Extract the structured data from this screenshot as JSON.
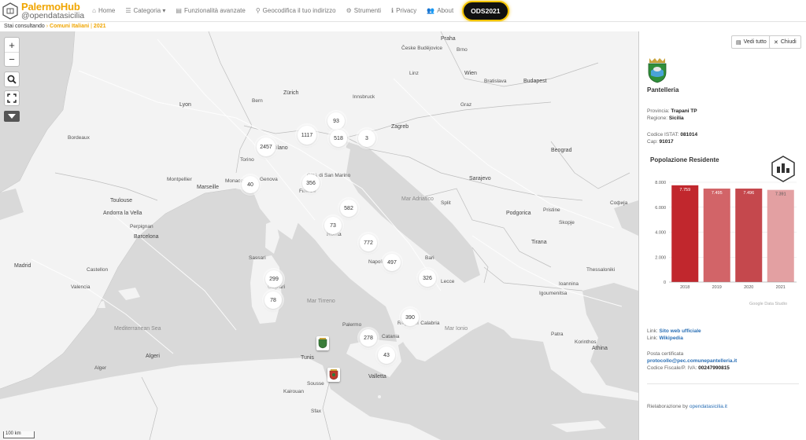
{
  "navbar": {
    "brand_name": "PalermoHub",
    "brand_sub": "@opendatasicilia",
    "items": [
      {
        "icon": "home-icon",
        "glyph": "⌂",
        "label": "Home"
      },
      {
        "icon": "list-icon",
        "glyph": "☰",
        "label": "Categoria ▾"
      },
      {
        "icon": "tasks-icon",
        "glyph": "▤",
        "label": "Funzionalità avanzate"
      },
      {
        "icon": "map-marker-icon",
        "glyph": "⚲",
        "label": "Geocodifica il tuo indirizzo"
      },
      {
        "icon": "gear-icon",
        "glyph": "⚙",
        "label": "Strumenti"
      },
      {
        "icon": "info-icon",
        "glyph": "ℹ",
        "label": "Privacy"
      },
      {
        "icon": "users-icon",
        "glyph": "👥",
        "label": "About"
      }
    ],
    "ods_label": "ODS2021",
    "ods_color": "#f5c400"
  },
  "breadcrumb": {
    "prefix": "Stai consultando",
    "section": "Comuni Italiani",
    "year": "2021"
  },
  "map": {
    "controls": {
      "zoom_in": "+",
      "zoom_out": "−"
    },
    "scale_label": "100 km",
    "clusters": [
      {
        "label": "93"
      },
      {
        "label": "1117"
      },
      {
        "label": "518"
      },
      {
        "label": "3"
      },
      {
        "label": "2457"
      },
      {
        "label": "40"
      },
      {
        "label": "356"
      },
      {
        "label": "582"
      },
      {
        "label": "73"
      },
      {
        "label": "772"
      },
      {
        "label": "497"
      },
      {
        "label": "299"
      },
      {
        "label": "326"
      },
      {
        "label": "78"
      },
      {
        "label": "390"
      },
      {
        "label": "278"
      },
      {
        "label": "43"
      }
    ],
    "places": [
      "Praha",
      "Česke Budějovice",
      "Brno",
      "Wien",
      "Bratislava",
      "Budapest",
      "Graz",
      "Linz",
      "Innsbruck",
      "Milano",
      "Torino",
      "Genova",
      "Zagreb",
      "Beograd",
      "Sarajevo",
      "Split",
      "Città di San Marino",
      "Monaco",
      "Andorra la Vella",
      "Firenze",
      "Roma",
      "Napoli",
      "Bari",
      "Podgorica",
      "Tirana",
      "Skopje",
      "Софија",
      "Pristine",
      "Sassari",
      "Cagliari",
      "Palermo",
      "Catania",
      "Reggio di Calabria",
      "Algeri",
      "Tunis",
      "Valletta",
      "Madrid",
      "Barcelona",
      "Valencia",
      "Castellon",
      "Alger",
      "Sfax",
      "Kairouan",
      "Sousse",
      "Patra",
      "Athina",
      "Korinthos",
      "Thessaloniki",
      "Igoumenitsa",
      "Ioannina",
      "Lyon",
      "Marseille",
      "Toulouse",
      "Bordeaux",
      "Perpignan",
      "Zürich",
      "Bern",
      "Montpellier",
      "Lecce"
    ],
    "seas": [
      "Mar Ionio",
      "Mar Tirreno",
      "Mar Adriatico",
      "Mediterranean Sea"
    ]
  },
  "panel": {
    "show_all_label": "Vedi tutto",
    "close_label": "Chiudi",
    "comune": "Pantelleria",
    "provincia_label": "Provincia:",
    "provincia": "Trapani TP",
    "regione_label": "Regione:",
    "regione": "Sicilia",
    "istat_label": "Codice ISTAT:",
    "istat": "081014",
    "cap_label": "Cap:",
    "cap": "91017",
    "chart_title": "Popolazione Residente",
    "link1_label": "Link:",
    "link1": "Sito web ufficiale",
    "link2_label": "Link:",
    "link2": "Wikipedia",
    "pec_label": "Posta certificata",
    "pec": "protocollo@pec.comunepantelleria.it",
    "cf_label": "Codice Fiscale/P. IVA:",
    "cf": "00247990815",
    "credit": "Google Data Studio",
    "footer_prefix": "Rielaborazione by",
    "footer_link": "opendatasicilia.it"
  },
  "chart_data": {
    "type": "bar",
    "title": "Popolazione Residente",
    "categories": [
      "2018",
      "2019",
      "2020",
      "2021"
    ],
    "values": [
      7759,
      7495,
      7496,
      7391
    ],
    "value_labels": [
      "7.759",
      "7.495",
      "7.496",
      "7.391"
    ],
    "ylim": [
      0,
      8000
    ],
    "yticks": [
      0,
      2000,
      4000,
      6000,
      8000
    ],
    "ytick_labels": [
      "0",
      "2.000",
      "4.000",
      "6.000",
      "8.000"
    ],
    "bar_colors": [
      "#c1272d",
      "#d26468",
      "#c5484d",
      "#e3a0a2"
    ],
    "grid": true
  }
}
